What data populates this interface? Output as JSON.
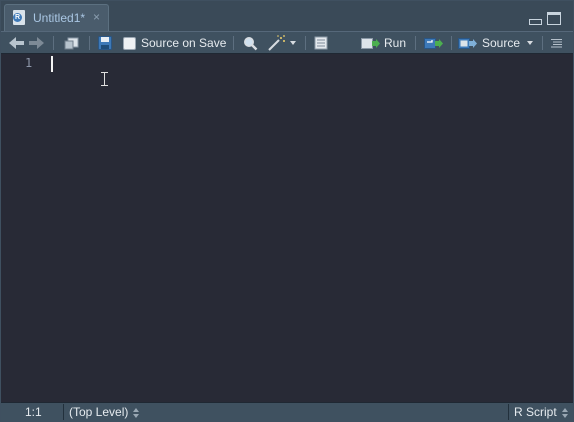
{
  "tab": {
    "title": "Untitled1*",
    "close": "×",
    "file_badge": "R"
  },
  "toolbar": {
    "source_on_save_label": "Source on Save",
    "source_on_save_checked": false,
    "run_label": "Run",
    "source_label": "Source"
  },
  "editor": {
    "line_numbers": [
      "1"
    ]
  },
  "status": {
    "position": "1:1",
    "scope": "(Top Level)",
    "file_type": "R Script"
  },
  "icons": {
    "back": "arrow-left-icon",
    "forward": "arrow-right-icon",
    "show_in_window": "popout-icon",
    "save": "save-icon",
    "find": "search-icon",
    "code_tools": "magic-wand-icon",
    "compile_report": "notebook-icon",
    "run": "run-icon",
    "rerun": "rerun-icon",
    "source": "source-icon",
    "outline": "outline-icon"
  },
  "colors": {
    "background": "#282a36",
    "toolbar": "#3f5160",
    "tab_text": "#aac7e4",
    "accent_blue": "#3d79b8",
    "green": "#4caf50"
  }
}
